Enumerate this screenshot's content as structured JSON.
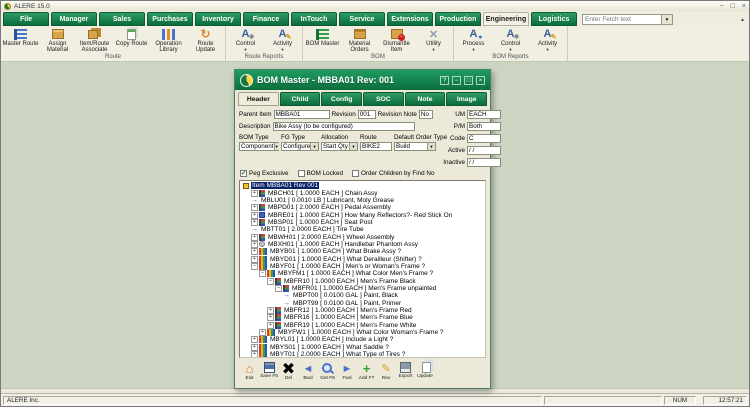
{
  "window": {
    "title": "ALERE 15.0",
    "controls": [
      {
        "name": "minimize",
        "glyph": "−"
      },
      {
        "name": "maximize",
        "glyph": "□"
      },
      {
        "name": "close",
        "glyph": "×"
      }
    ]
  },
  "menu_tabs": [
    {
      "label": "File",
      "active": false
    },
    {
      "label": "Manager",
      "active": false
    },
    {
      "label": "Sales",
      "active": false
    },
    {
      "label": "Purchases",
      "active": false
    },
    {
      "label": "Inventory",
      "active": false
    },
    {
      "label": "Finance",
      "active": false
    },
    {
      "label": "InTouch",
      "active": false
    },
    {
      "label": "Service",
      "active": false
    },
    {
      "label": "Extensions",
      "active": false
    },
    {
      "label": "Production",
      "active": false
    },
    {
      "label": "Engineering",
      "active": true
    },
    {
      "label": "Logistics",
      "active": false
    }
  ],
  "fetch": {
    "placeholder": "Enter Fetch text"
  },
  "ribbon": {
    "groups": [
      {
        "label": "Route",
        "buttons": [
          {
            "label": "Master Route",
            "icon": "list-icon",
            "dropdown": false
          },
          {
            "label": "Assign Material",
            "icon": "box-arrow-icon",
            "dropdown": false
          },
          {
            "label": "Item/Route Associate",
            "icon": "boxes-icon",
            "dropdown": false
          },
          {
            "label": "Copy Route",
            "icon": "copy-icon",
            "dropdown": false
          },
          {
            "label": "Operation Library",
            "icon": "chart-icon",
            "dropdown": false
          },
          {
            "label": "Route Update",
            "icon": "refresh-icon",
            "dropdown": false
          }
        ]
      },
      {
        "label": "Route Reports",
        "buttons": [
          {
            "label": "Control",
            "icon": "report-gear-icon",
            "dropdown": true
          },
          {
            "label": "Activity",
            "icon": "report-pencil-icon",
            "dropdown": true
          }
        ]
      },
      {
        "label": "BOM",
        "buttons": [
          {
            "label": "BOM Master",
            "icon": "tree-icon",
            "dropdown": false
          },
          {
            "label": "Material Orders",
            "icon": "box-icon",
            "dropdown": false
          },
          {
            "label": "Dismantle Item",
            "icon": "box-minus-icon",
            "dropdown": false
          },
          {
            "label": "Utility",
            "icon": "tools-icon",
            "dropdown": true
          }
        ]
      },
      {
        "label": "BOM Reports",
        "buttons": [
          {
            "label": "Process",
            "icon": "report-person-icon",
            "dropdown": true
          },
          {
            "label": "Control",
            "icon": "report-gear-icon",
            "dropdown": true
          },
          {
            "label": "Activity",
            "icon": "report-pencil-icon",
            "dropdown": true
          }
        ]
      }
    ]
  },
  "dialog": {
    "title": "BOM Master - MBBA01  Rev: 001",
    "controls": [
      {
        "name": "help",
        "glyph": "?"
      },
      {
        "name": "minimize",
        "glyph": "−"
      },
      {
        "name": "maximize",
        "glyph": "□"
      },
      {
        "name": "close",
        "glyph": "×"
      }
    ],
    "tabs": [
      {
        "label": "Header",
        "active": true
      },
      {
        "label": "Child",
        "active": false
      },
      {
        "label": "Config",
        "active": false
      },
      {
        "label": "SOC",
        "active": false
      },
      {
        "label": "Note",
        "active": false
      },
      {
        "label": "Image",
        "active": false
      }
    ],
    "fields": {
      "parent_item": {
        "label": "Parent Item",
        "value": "MBBA01"
      },
      "revision": {
        "label": "Revision",
        "value": "001"
      },
      "revision_note": {
        "label": "Revision Note",
        "value": "No"
      },
      "description": {
        "label": "Description",
        "value": "Bike Assy (to be configured)"
      },
      "bom_type": {
        "label": "BOM Type",
        "value": "Component"
      },
      "fg_type": {
        "label": "FG Type",
        "value": "Configure"
      },
      "allocation": {
        "label": "Allocation",
        "value": "Start Qty"
      },
      "route": {
        "label": "Route",
        "value": "BIKE2"
      },
      "default_order_type": {
        "label": "Default Order Type",
        "value": "Build"
      },
      "um": {
        "label": "UM",
        "value": "EACH"
      },
      "pm": {
        "label": "P/M",
        "value": "Both"
      },
      "code": {
        "label": "Code",
        "value": "C"
      },
      "active": {
        "label": "Active",
        "value": "/ /"
      },
      "inactive": {
        "label": "Inactive",
        "value": "/ /"
      }
    },
    "checkboxes": [
      {
        "label": "Peg Exclusive",
        "checked": true
      },
      {
        "label": "BOM Locked",
        "checked": false
      },
      {
        "label": "Order Children by Find No",
        "checked": false
      }
    ],
    "tree": [
      {
        "label": "Item MBBA01 Rev 001",
        "indent": 0,
        "expander": "none",
        "icon": "root",
        "selected": true
      },
      {
        "label": "MBCH01 [ 1.0000 EACH ] Chain Assy",
        "indent": 1,
        "expander": "plus",
        "icon": "bom",
        "selected": false
      },
      {
        "label": "MBLU01 [ 0.0010 LB ] Lubricant, Moly Grease",
        "indent": 1,
        "expander": "none",
        "icon": "leaf",
        "selected": false
      },
      {
        "label": "MBPD01 [ 2.0000 EACH ] Pedal Assembly",
        "indent": 1,
        "expander": "plus",
        "icon": "bom",
        "selected": false
      },
      {
        "label": "MBRE01 [ 1.0000 EACH ] How Many Reflectors?- Red Stick On",
        "indent": 1,
        "expander": "plus",
        "icon": "ref",
        "selected": false
      },
      {
        "label": "MBSP01 [ 1.0000 EACH ] Seat Post",
        "indent": 1,
        "expander": "plus",
        "icon": "bom",
        "selected": false
      },
      {
        "label": "MBTT01 [ 2.0000 EACH ] Tire Tube",
        "indent": 1,
        "expander": "none",
        "icon": "leaf",
        "selected": false
      },
      {
        "label": "MBWH01 [ 2.0000 EACH ] Wheel Assembly",
        "indent": 1,
        "expander": "plus",
        "icon": "bom",
        "selected": false
      },
      {
        "label": "MBXH01 [ 1.0000 EACH ] Handlebar Phantom Assy",
        "indent": 1,
        "expander": "plus",
        "icon": "phantom",
        "selected": false
      },
      {
        "label": "MBYB01 [ 1.0000 EACH ] What Brake Assy ?",
        "indent": 1,
        "expander": "plus",
        "icon": "question",
        "selected": false
      },
      {
        "label": "MBYD01 [ 1.0000 EACH ] What Derailleur (Shifter) ?",
        "indent": 1,
        "expander": "plus",
        "icon": "question",
        "selected": false
      },
      {
        "label": "MBYF01 [ 1.0000 EACH ] Men's or Woman's Frame ?",
        "indent": 1,
        "expander": "minus",
        "icon": "question",
        "selected": false
      },
      {
        "label": "MBYFM1 [ 1.0000 EACH ] What Color Men's Frame ?",
        "indent": 2,
        "expander": "minus",
        "icon": "question",
        "selected": false
      },
      {
        "label": "MBFR10 [ 1.0000 EACH ] Men's Frame Black",
        "indent": 3,
        "expander": "minus",
        "icon": "bom",
        "selected": false
      },
      {
        "label": "MBFR01 [ 1.0000 EACH ] Men's Frame unpainted",
        "indent": 4,
        "expander": "minus",
        "icon": "bom",
        "selected": false
      },
      {
        "label": "MBPT00 [ 0.0100 GAL ] Paint, Black",
        "indent": 5,
        "expander": "none",
        "icon": "leaf",
        "selected": false
      },
      {
        "label": "MBPT99 [ 0.0100 GAL ] Paint, Primer",
        "indent": 5,
        "expander": "none",
        "icon": "leaf",
        "selected": false
      },
      {
        "label": "MBFR12 [ 1.0000 EACH ] Men's Frame Red",
        "indent": 3,
        "expander": "plus",
        "icon": "bom",
        "selected": false
      },
      {
        "label": "MBFR16 [ 1.0000 EACH ] Men's Frame Blue",
        "indent": 3,
        "expander": "plus",
        "icon": "bom",
        "selected": false
      },
      {
        "label": "MBFR19 [ 1.0000 EACH ] Men's Frame White",
        "indent": 3,
        "expander": "plus",
        "icon": "bom",
        "selected": false
      },
      {
        "label": "MBYFW1 [ 1.0000 EACH ] What Color Woman's Frame ?",
        "indent": 2,
        "expander": "plus",
        "icon": "question",
        "selected": false
      },
      {
        "label": "MBYL01 [ 1.0000 EACH ] Include a Light ?",
        "indent": 1,
        "expander": "plus",
        "icon": "question",
        "selected": false
      },
      {
        "label": "MBYS01 [ 1.0000 EACH ] What Saddle ?",
        "indent": 1,
        "expander": "plus",
        "icon": "question",
        "selected": false
      },
      {
        "label": "MBYT01 [ 2.0000 EACH ] What Type of Tires ?",
        "indent": 1,
        "expander": "plus",
        "icon": "question",
        "selected": false
      }
    ],
    "toolbar": [
      {
        "label": "Exit",
        "icon": "home"
      },
      {
        "label": "Save F5",
        "icon": "floppy"
      },
      {
        "label": "Del",
        "icon": "delete"
      },
      {
        "label": "Bwd",
        "icon": "arrow-left"
      },
      {
        "label": "Get F8",
        "icon": "search"
      },
      {
        "label": "Fwd",
        "icon": "arrow-right"
      },
      {
        "label": "Add F7",
        "icon": "plus"
      },
      {
        "label": "Rev",
        "icon": "pencil"
      },
      {
        "label": "Export",
        "icon": "export"
      },
      {
        "label": "Update",
        "icon": "pages"
      }
    ]
  },
  "status_bar": {
    "company": "ALERE Inc.",
    "num": "NUM",
    "time": "12:57:21"
  },
  "colors": {
    "brand_green": "#0c6e3e",
    "tab_green": "#0b6c3b",
    "selection_blue": "#0a246a",
    "desktop": "#cbd5c1"
  }
}
